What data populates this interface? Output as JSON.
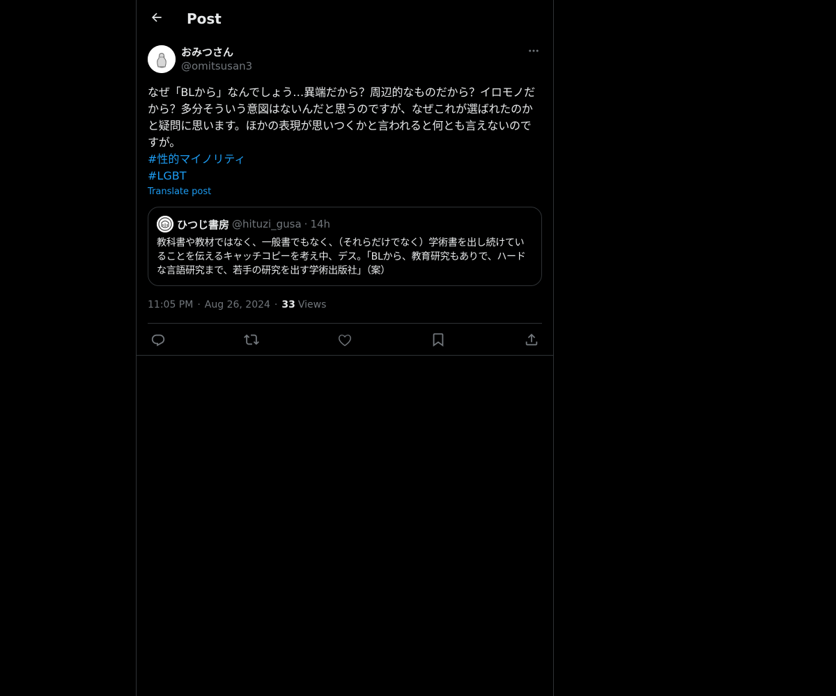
{
  "header": {
    "title": "Post",
    "back_icon": "arrow-left-icon"
  },
  "post": {
    "author": {
      "name": "おみつさん",
      "handle": "@omitsusan3",
      "avatar_icon": "avatar-sketch"
    },
    "text": "なぜ「BLから」なんでしょう…異端だから？周辺的なものだから？イロモノだから？多分そういう意図はないんだと思うのですが、なぜこれが選ばれたのかと疑問に思います。ほかの表現が思いつくかと言われると何とも言えないのですが。",
    "hashtags": [
      "#性的マイノリティ",
      "#LGBT"
    ],
    "translate_label": "Translate post",
    "more_icon": "more-horizontal-icon",
    "quote": {
      "name": "ひつじ書房",
      "handle": "@hituzi_gusa",
      "dot": "·",
      "time": "14h",
      "text": "教科書や教材ではなく、一般書でもなく、（それらだけでなく）学術書を出し続けていることを伝えるキャッチコピーを考え中、デス。「BLから、教育研究もありで、ハードな言語研究まで、若手の研究を出す学術出版社」（案）"
    },
    "meta": {
      "time": "11:05 PM",
      "sep": "·",
      "date": "Aug 26, 2024",
      "views_count": "33",
      "views_label": "Views"
    },
    "actions": [
      "reply-icon",
      "repost-icon",
      "like-icon",
      "bookmark-icon",
      "share-icon"
    ]
  },
  "colors": {
    "background": "#000000",
    "text": "#e7e9ea",
    "muted": "#71767b",
    "accent": "#1d9bf0",
    "border": "#2f3336"
  }
}
